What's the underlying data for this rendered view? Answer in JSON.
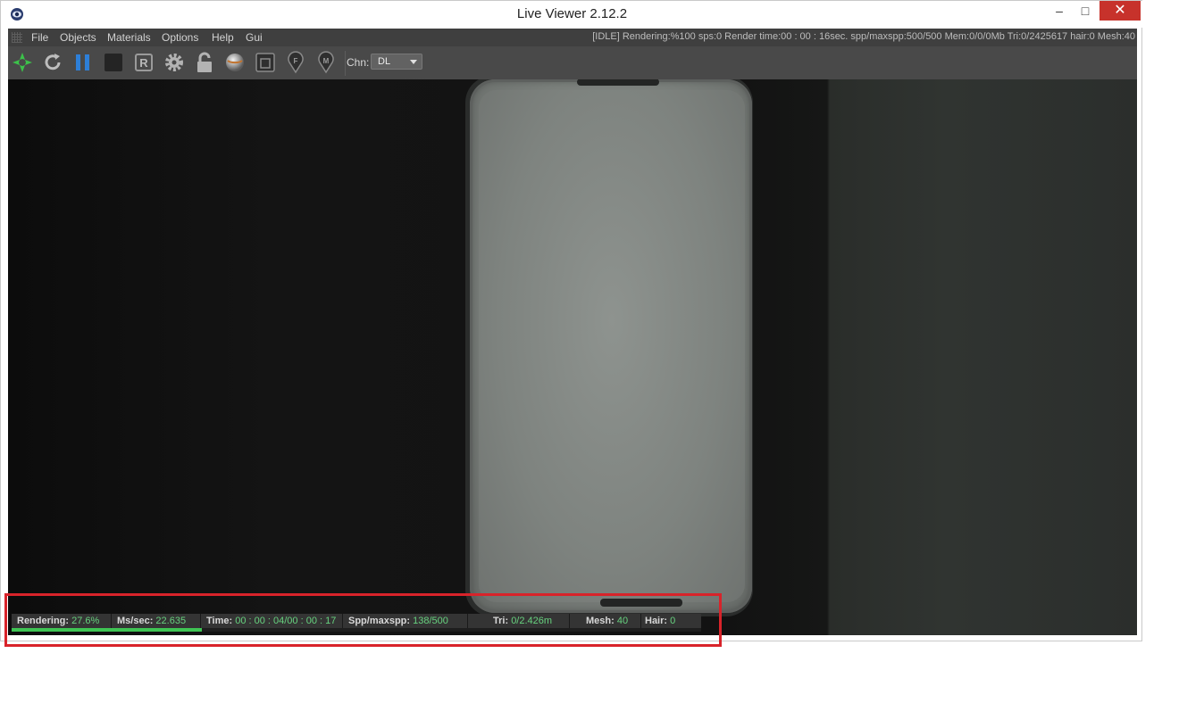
{
  "window": {
    "title": "Live Viewer 2.12.2",
    "minimize": "–",
    "maximize": "□",
    "close": "✕"
  },
  "menu": {
    "items": [
      "File",
      "Objects",
      "Materials",
      "Options",
      "Help",
      "Gui"
    ]
  },
  "header_status": "[IDLE]  Rendering:%100 sps:0 Render time:00 : 00 : 16sec. spp/maxspp:500/500 Mem:0/0/0Mb Tri:0/2425617 hair:0 Mesh:40",
  "toolbar": {
    "icons": [
      "octane-logo-icon",
      "refresh-icon",
      "pause-icon",
      "stop-icon",
      "r-icon",
      "gear-icon",
      "lock-icon",
      "sphere-icon",
      "region-icon",
      "pin-f-icon",
      "pin-m-icon"
    ],
    "channel_label": "Chn:",
    "channel_value": "DL"
  },
  "render_status": {
    "rendering_label": "Rendering:",
    "rendering_value": "27.6%",
    "progress": 0.276,
    "ms_label": "Ms/sec:",
    "ms_value": "22.635",
    "time_label": "Time:",
    "time_value": "00 : 00 : 04/00 : 00 : 17",
    "spp_label": "Spp/maxspp:",
    "spp_value": "138/500",
    "tri_label": "Tri:",
    "tri_value": "0/2.426m",
    "mesh_label": "Mesh:",
    "mesh_value": "40",
    "hair_label": "Hair:",
    "hair_value": "0"
  },
  "colors": {
    "accent_green": "#67d27f",
    "progress_green": "#3fc454",
    "highlight_red": "#d8232a",
    "close_red": "#c7322b"
  }
}
